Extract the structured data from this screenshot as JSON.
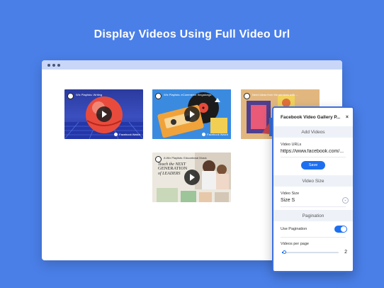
{
  "headline": "Display Videos Using Full Video Url",
  "videos": [
    {
      "title": "Wix Playlists: Writing",
      "sub": "",
      "source": "Facebook Watch",
      "theme": "ball"
    },
    {
      "title": "Wix Playlists: eCommerce Singalongs",
      "sub": "",
      "source": "Facebook Watch",
      "theme": "cassette"
    },
    {
      "title": "Need ideas from the services with ...",
      "sub": "",
      "source": "",
      "theme": "art"
    },
    {
      "title": "A Wix Playlists: Educational Music",
      "sub": "",
      "source": "",
      "theme": "book"
    }
  ],
  "book_cover": {
    "line1": "Teach the NEXT",
    "line2": "GENERATION",
    "line3": "of LEADERS"
  },
  "panel": {
    "title": "Facebook Video Gallery P...",
    "close": "×",
    "add_videos_section": "Add Videos",
    "video_urls_label": "Video URLs",
    "video_url_value": "https://www.facebook.com/...",
    "save_label": "Save",
    "video_size_section": "Video Size",
    "video_size_label": "Video Size",
    "video_size_value": "Size S",
    "pagination_section": "Pagination",
    "use_pagination_label": "Use Pagination",
    "use_pagination_on": true,
    "videos_per_page_label": "Videos per page",
    "videos_per_page_value": "2",
    "videos_per_page_fraction": 0.04
  },
  "colors": {
    "background": "#4a7fe8",
    "accent": "#1e6ff0",
    "browser_bar": "#c9d6f7"
  }
}
